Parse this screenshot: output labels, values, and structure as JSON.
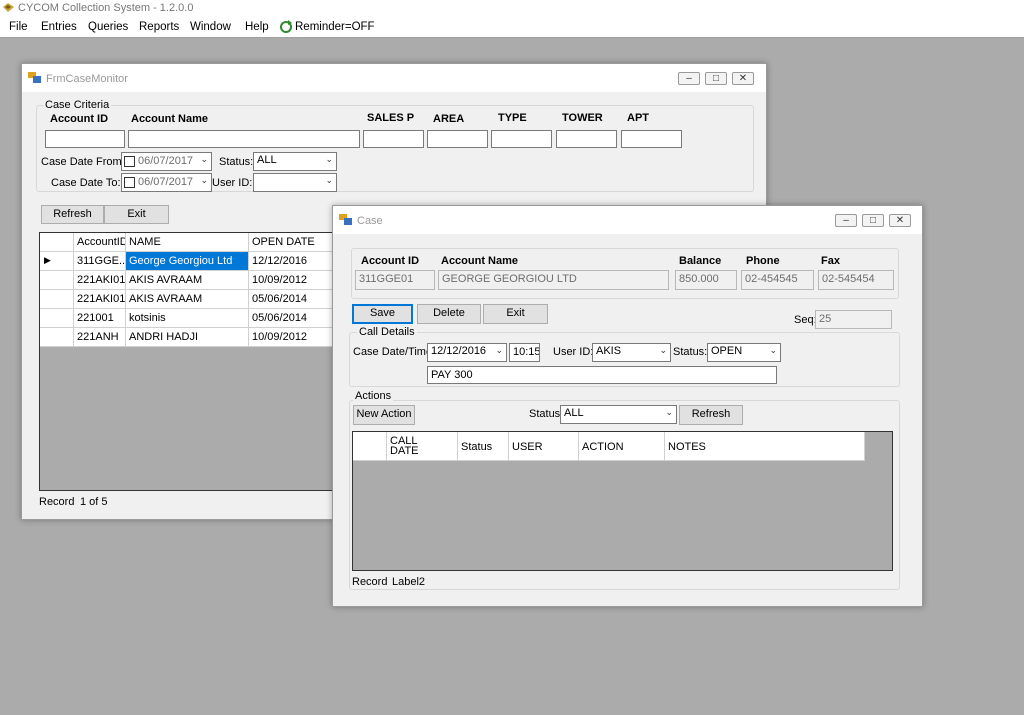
{
  "app": {
    "title": "CYCOM Collection System - 1.2.0.0"
  },
  "menu": {
    "items": [
      "File",
      "Entries",
      "Queries",
      "Reports",
      "Window",
      "Help"
    ],
    "reminder": "Reminder=OFF"
  },
  "monitor": {
    "title": "FrmCaseMonitor",
    "criteria_label": "Case Criteria",
    "headers": {
      "account_id": "Account ID",
      "account_name": "Account Name",
      "sales": "SALES P",
      "area": "AREA",
      "type": "TYPE",
      "tower": "TOWER",
      "apt": "APT"
    },
    "date_from_label": "Case Date From:",
    "date_to_label": "Case Date To:",
    "date_from": "06/07/2017",
    "date_to": "06/07/2017",
    "status_label": "Status:",
    "status_value": "ALL",
    "userid_label": "User ID:",
    "userid_value": "",
    "refresh": "Refresh",
    "exit": "Exit",
    "grid": {
      "columns": [
        "AccountID",
        "NAME",
        "OPEN DATE"
      ],
      "rows": [
        [
          "311GGE...",
          "George Georgiou Ltd",
          "12/12/2016"
        ],
        [
          "221AKI01",
          "AKIS AVRAAM",
          "10/09/2012"
        ],
        [
          "221AKI01",
          "AKIS AVRAAM",
          "05/06/2014"
        ],
        [
          "221001",
          "kotsinis",
          "05/06/2014"
        ],
        [
          "221ANH",
          "ANDRI HADJI",
          "10/09/2012"
        ]
      ]
    },
    "record_label": "Record",
    "record_value": "1 of 5"
  },
  "case": {
    "title": "Case",
    "headers": {
      "account_id": "Account ID",
      "account_name": "Account Name",
      "balance": "Balance",
      "phone": "Phone",
      "fax": "Fax"
    },
    "values": {
      "account_id": "311GGE01",
      "account_name": "GEORGE GEORGIOU LTD",
      "balance": "850.000",
      "phone": "02-454545",
      "fax": "02-545454"
    },
    "save": "Save",
    "delete": "Delete",
    "exit": "Exit",
    "seq_label": "Seq:",
    "seq_value": "25",
    "call_details_label": "Call Details",
    "case_datetime_label": "Case Date/Time:",
    "case_date": "12/12/2016",
    "case_time": "10:15",
    "userid_label": "User ID:",
    "userid_value": "AKIS",
    "status_label": "Status:",
    "status_value": "OPEN",
    "note": "PAY 300",
    "actions_label": "Actions",
    "new_action": "New Action",
    "actions_status_label": "Status",
    "actions_status_value": "ALL",
    "refresh": "Refresh",
    "grid_columns": [
      "CALL\nDATE",
      "Status",
      "USER",
      "ACTION",
      "NOTES"
    ],
    "record_label": "Record",
    "record_value": "Label2"
  }
}
